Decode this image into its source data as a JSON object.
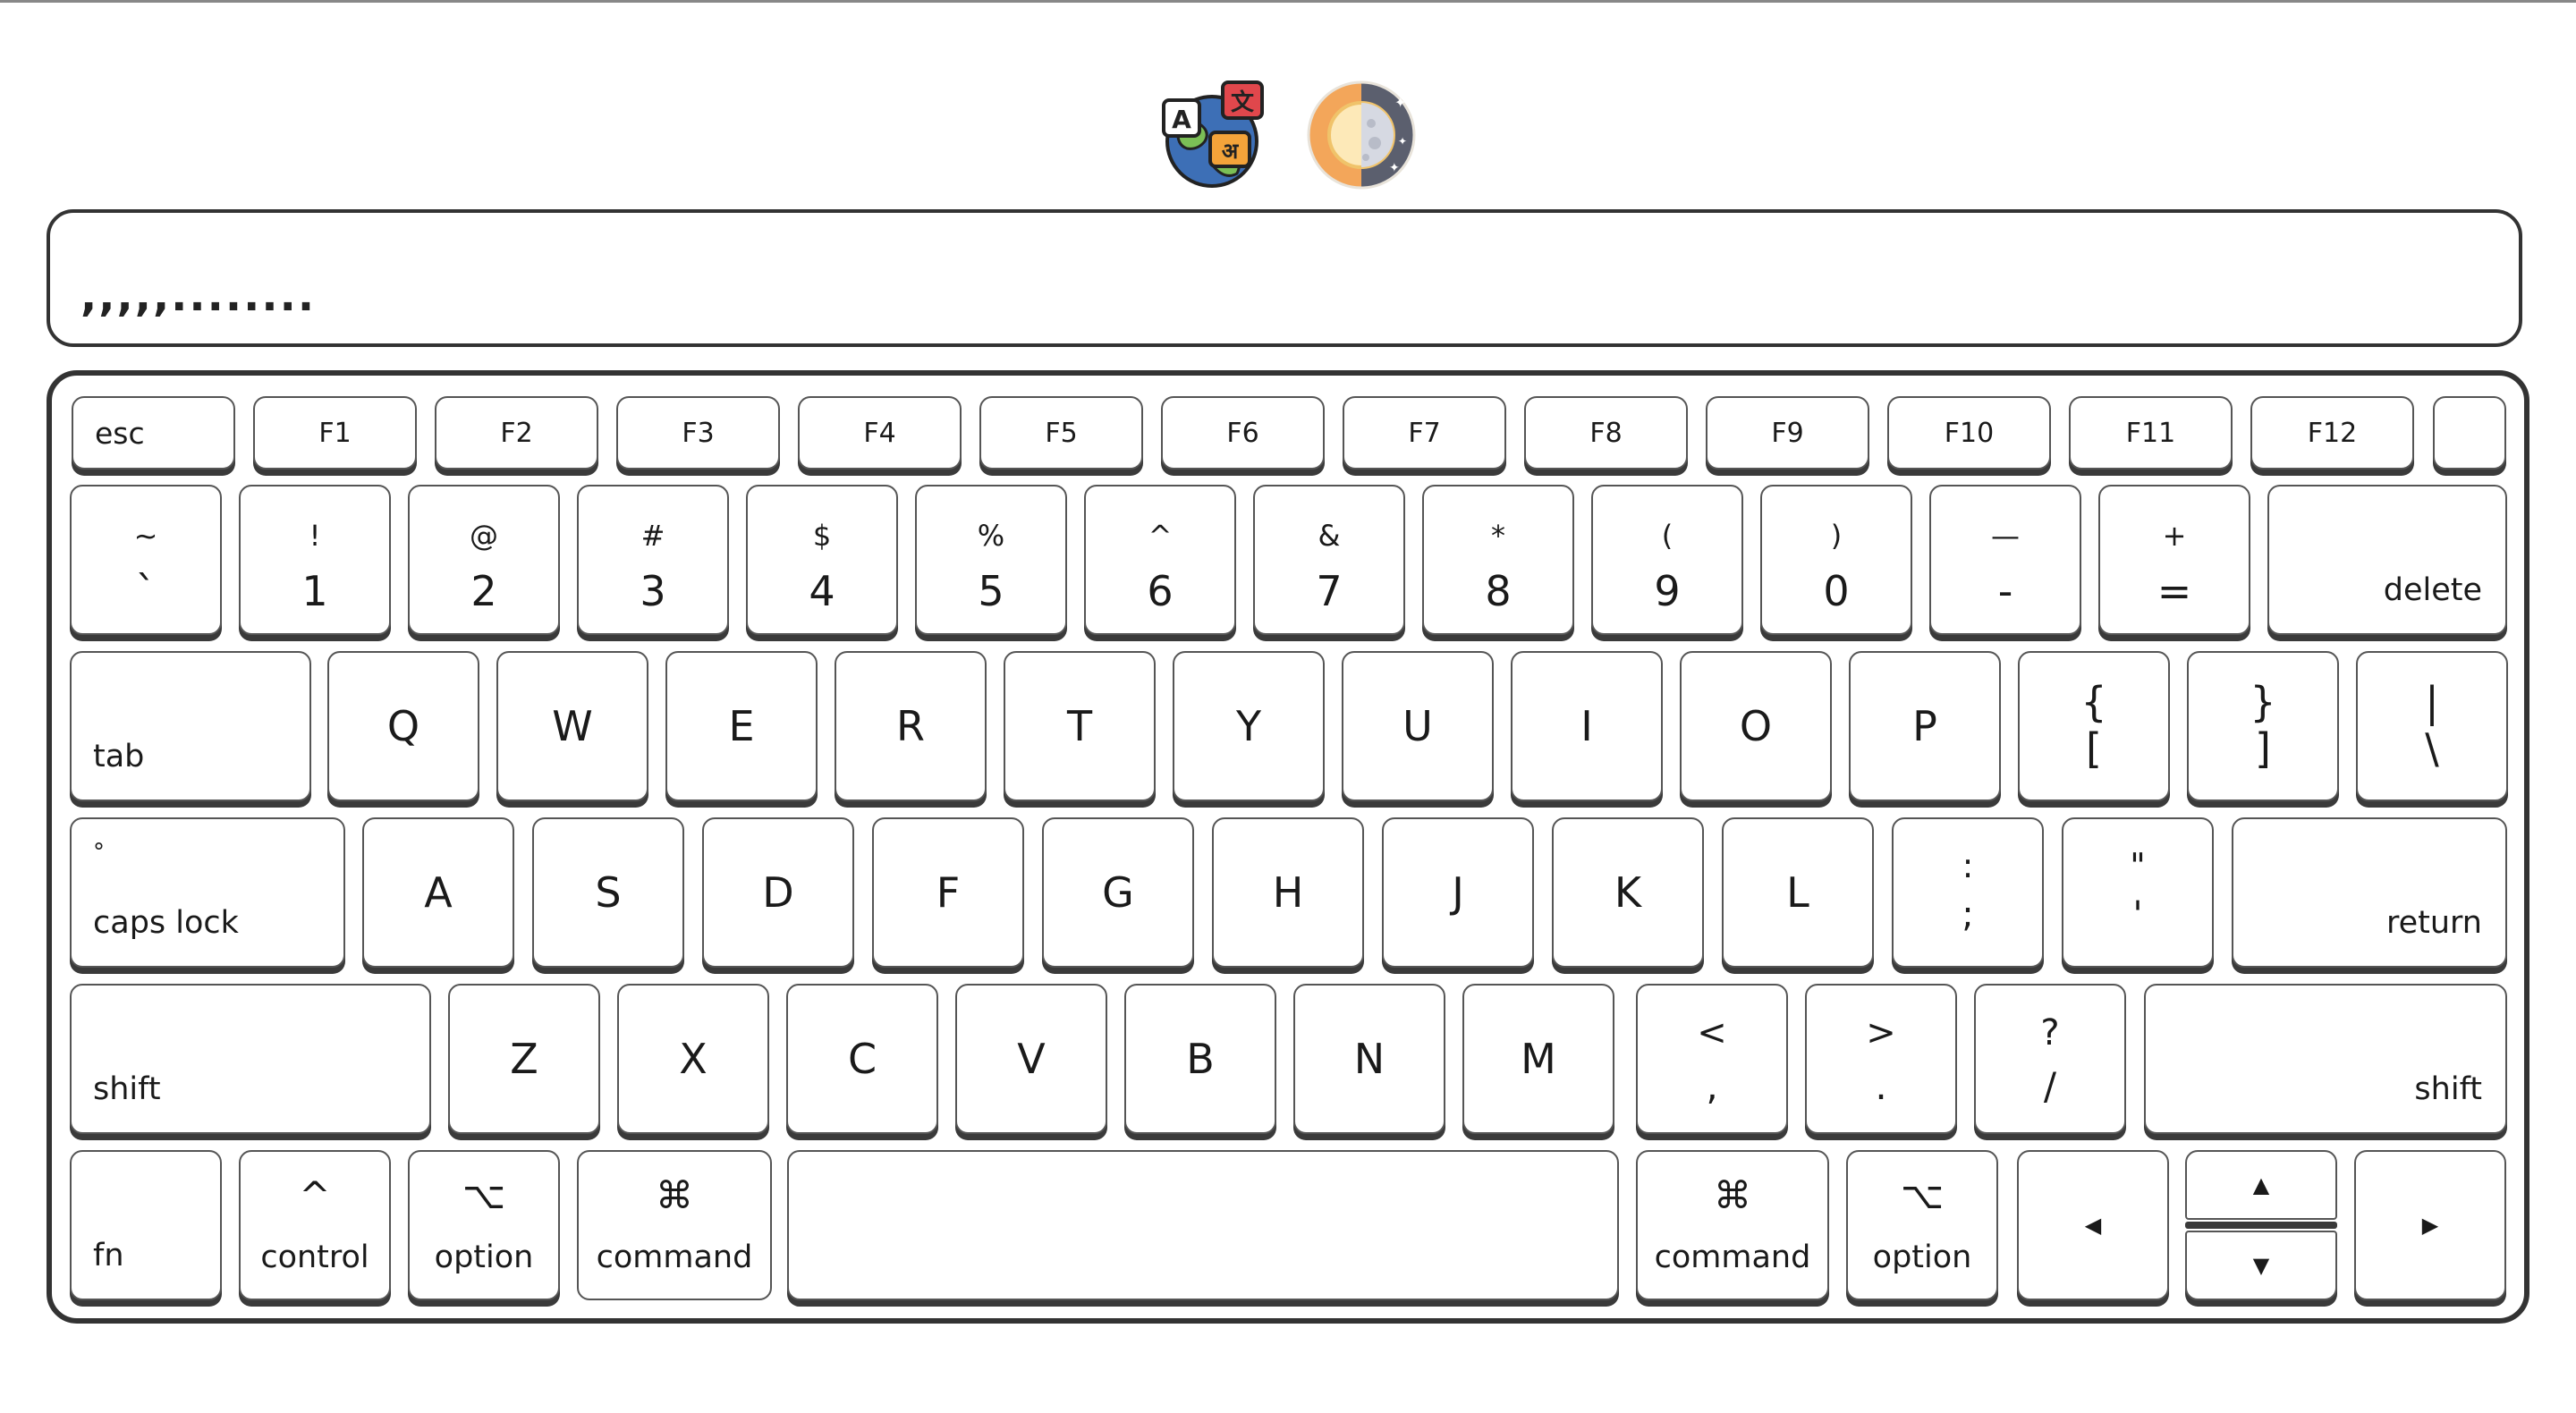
{
  "text_output": ",,,,,........",
  "toolbar": {
    "language_icon": "language-globe-icon",
    "theme_icon": "day-night-toggle-icon"
  },
  "colors": {
    "key_shadow": "#3a3a3a",
    "border": "#333333",
    "sun_orange": "#f3a65a",
    "moon_gray": "#5b5f6e",
    "globe_blue": "#3d6fb6",
    "globe_green": "#7bbf56",
    "bubble_red": "#e0474c",
    "bubble_orange": "#f3a33a"
  },
  "keyboard": {
    "fn_row": [
      "esc",
      "F1",
      "F2",
      "F3",
      "F4",
      "F5",
      "F6",
      "F7",
      "F8",
      "F9",
      "F10",
      "F11",
      "F12",
      ""
    ],
    "number_row": [
      {
        "top": "~",
        "bottom": "`"
      },
      {
        "top": "!",
        "bottom": "1"
      },
      {
        "top": "@",
        "bottom": "2"
      },
      {
        "top": "#",
        "bottom": "3"
      },
      {
        "top": "$",
        "bottom": "4"
      },
      {
        "top": "%",
        "bottom": "5"
      },
      {
        "top": "^",
        "bottom": "6"
      },
      {
        "top": "&",
        "bottom": "7"
      },
      {
        "top": "*",
        "bottom": "8"
      },
      {
        "top": "(",
        "bottom": "9"
      },
      {
        "top": ")",
        "bottom": "0"
      },
      {
        "top": "—",
        "bottom": "-"
      },
      {
        "top": "+",
        "bottom": "="
      }
    ],
    "delete": "delete",
    "tab": "tab",
    "qwerty_row": [
      "Q",
      "W",
      "E",
      "R",
      "T",
      "Y",
      "U",
      "I",
      "O",
      "P"
    ],
    "bracket_keys": [
      {
        "top": "{",
        "bottom": "["
      },
      {
        "top": "}",
        "bottom": "]"
      },
      {
        "top": "|",
        "bottom": "\\"
      }
    ],
    "caps_lock": "caps lock",
    "caps_indicator": "°",
    "home_row": [
      "A",
      "S",
      "D",
      "F",
      "G",
      "H",
      "J",
      "K",
      "L"
    ],
    "home_punct": [
      {
        "top": ":",
        "bottom": ";"
      },
      {
        "top": "\"",
        "bottom": "'"
      }
    ],
    "return": "return",
    "shift_left": "shift",
    "bottom_row": [
      "Z",
      "X",
      "C",
      "V",
      "B",
      "N",
      "M"
    ],
    "bottom_punct": [
      {
        "top": "<",
        "bottom": ","
      },
      {
        "top": ">",
        "bottom": "."
      },
      {
        "top": "?",
        "bottom": "/"
      }
    ],
    "shift_right": "shift",
    "fn": "fn",
    "control": {
      "symbol": "^",
      "label": "control"
    },
    "option_left": {
      "symbol": "⌥",
      "label": "option"
    },
    "command_left": {
      "symbol": "⌘",
      "label": "command"
    },
    "command_right": {
      "symbol": "⌘",
      "label": "command"
    },
    "option_right": {
      "symbol": "⌥",
      "label": "option"
    },
    "arrows": {
      "left": "◀",
      "up": "▲",
      "down": "▼",
      "right": "▶"
    }
  }
}
